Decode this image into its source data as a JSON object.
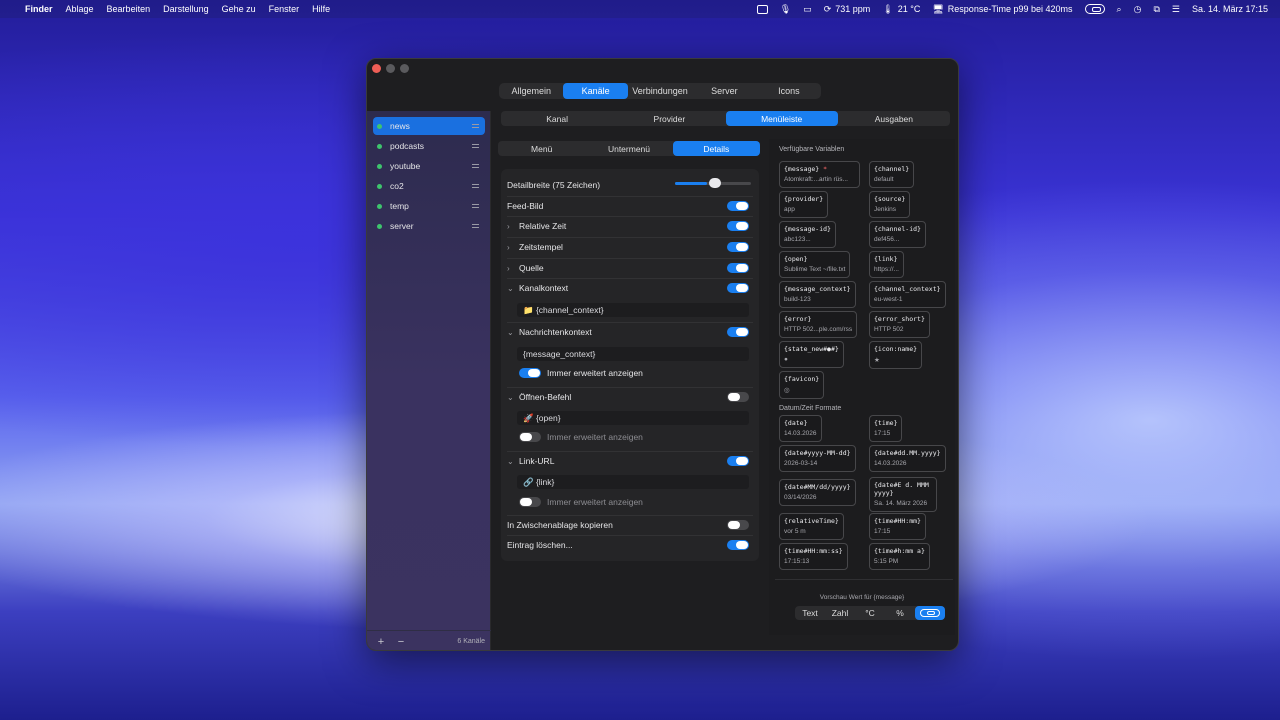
{
  "menubar": {
    "apple": "",
    "app": "Finder",
    "menus": [
      "Ablage",
      "Bearbeiten",
      "Darstellung",
      "Gehe zu",
      "Fenster",
      "Hilfe"
    ],
    "status": {
      "ppm": "731 ppm",
      "temp": "21 °C",
      "response": "Response-Time p99 bei 420ms",
      "clock": "Sa. 14. März  17:15"
    }
  },
  "window": {
    "top_tabs": [
      "Allgemein",
      "Kanäle",
      "Verbindungen",
      "Server",
      "Icons"
    ],
    "top_tab_active": "Kanäle",
    "sub_tabs": [
      "Kanal",
      "Provider",
      "Menüleiste",
      "Ausgaben"
    ],
    "sub_tab_active": "Menüleiste",
    "menu_tabs": [
      "Menü",
      "Untermenü",
      "Details"
    ],
    "menu_tab_active": "Details",
    "sidebar": {
      "items": [
        {
          "label": "news",
          "active": true
        },
        {
          "label": "podcasts"
        },
        {
          "label": "youtube"
        },
        {
          "label": "co2"
        },
        {
          "label": "temp"
        },
        {
          "label": "server"
        }
      ],
      "add": "+",
      "remove": "−",
      "count": "6 Kanäle"
    },
    "details": {
      "width_label": "Detailbreite (75 Zeichen)",
      "width_value": 0.42,
      "feed_image": "Feed-Bild",
      "relative_time": "Relative Zeit",
      "timestamp": "Zeitstempel",
      "source": "Quelle",
      "channel_context": "Kanalkontext",
      "channel_context_value": "📁 {channel_context}",
      "message_context": "Nachrichtenkontext",
      "message_context_value": "{message_context}",
      "always_expand": "Immer erweitert anzeigen",
      "open_command": "Öffnen-Befehl",
      "open_command_value": "🚀 {open}",
      "link_url": "Link-URL",
      "link_url_value": "🔗 {link}",
      "copy_clipboard": "In Zwischenablage kopieren",
      "delete_entry": "Eintrag löschen..."
    },
    "variables": {
      "title": "Verfügbare Variablen",
      "items": [
        {
          "key": "{message}",
          "req": "*",
          "value": "Atomkraft:...artin rüs..."
        },
        {
          "key": "{channel}",
          "value": "default"
        },
        {
          "key": "{provider}",
          "value": "app"
        },
        {
          "key": "{source}",
          "value": "Jenkins"
        },
        {
          "key": "{message-id}",
          "value": "abc123..."
        },
        {
          "key": "{channel-id}",
          "value": "def456..."
        },
        {
          "key": "{open}",
          "value": "Sublime Text ~/file.txt"
        },
        {
          "key": "{link}",
          "value": "https://..."
        },
        {
          "key": "{message_context}",
          "value": "build-123"
        },
        {
          "key": "{channel_context}",
          "value": "eu-west-1"
        },
        {
          "key": "{error}",
          "value": "HTTP 502...ple.com/rss"
        },
        {
          "key": "{error_short}",
          "value": "HTTP 502"
        },
        {
          "key": "{state_new#●#}",
          "value": "●"
        },
        {
          "key": "{icon:name}",
          "value": "★"
        },
        {
          "key": "{favicon}",
          "value": "◎"
        }
      ],
      "date_title": "Datum/Zeit Formate",
      "date_items": [
        {
          "key": "{date}",
          "value": "14.03.2026"
        },
        {
          "key": "{time}",
          "value": "17:15"
        },
        {
          "key": "{date#yyyy-MM-dd}",
          "value": "2026-03-14"
        },
        {
          "key": "{date#dd.MM.yyyy}",
          "value": "14.03.2026"
        },
        {
          "key": "{date#MM/dd/yyyy}",
          "value": "03/14/2026"
        },
        {
          "key": "{date#E d. MMM yyyy}",
          "value": "Sa. 14. März 2026"
        },
        {
          "key": "{relativeTime}",
          "value": "vor 5 m"
        },
        {
          "key": "{time#HH:mm}",
          "value": "17:15"
        },
        {
          "key": "{time#HH:mm:ss}",
          "value": "17:15:13"
        },
        {
          "key": "{time#h:mm a}",
          "value": "5:15 PM"
        }
      ],
      "preview_label": "Vorschau Wert für {message}",
      "preview_tabs": [
        "Text",
        "Zahl",
        "°C",
        "%"
      ]
    }
  }
}
